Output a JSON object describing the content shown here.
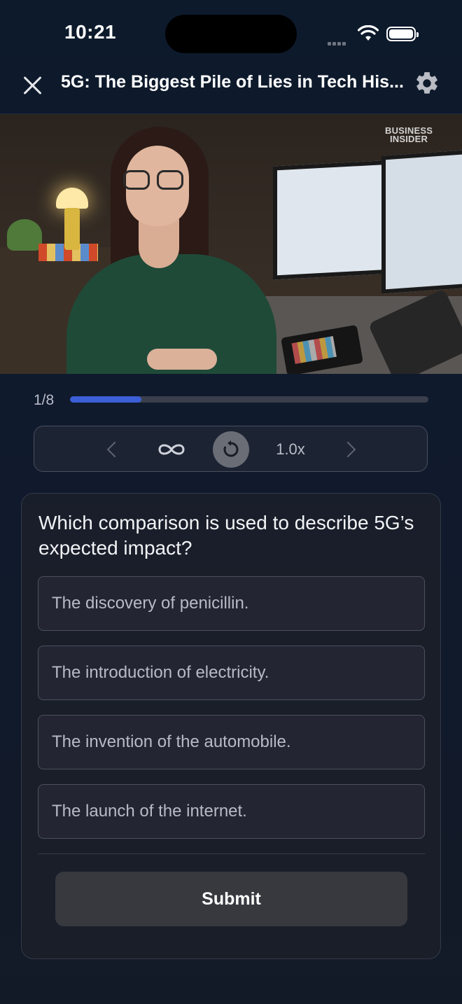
{
  "status_bar": {
    "time": "10:21"
  },
  "header": {
    "title": "5G: The Biggest Pile of Lies in Tech His..."
  },
  "video": {
    "watermark_line1": "BUSINESS",
    "watermark_line2": "INSIDER"
  },
  "progress": {
    "label": "1/8",
    "current": 1,
    "total": 8,
    "fill_fraction": 0.2
  },
  "controls": {
    "speed": "1.0x"
  },
  "quiz": {
    "question": "Which comparison is used to describe 5G’s expected impact?",
    "options": [
      "The discovery of penicillin.",
      "The introduction of electricity.",
      "The invention of the automobile.",
      "The launch of the internet."
    ],
    "submit_label": "Submit"
  },
  "colors": {
    "accent": "#3b5fd6",
    "background": "#0f1a2d",
    "card": "#1c202a"
  }
}
